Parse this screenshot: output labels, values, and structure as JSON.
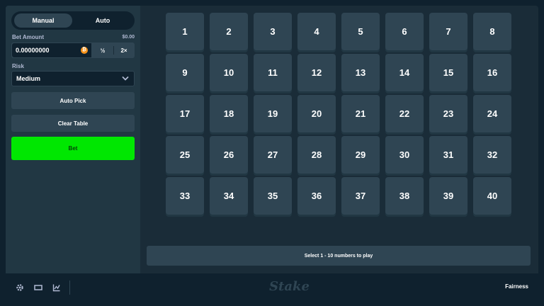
{
  "sidebar": {
    "modes": [
      "Manual",
      "Auto"
    ],
    "bet_amount_label": "Bet Amount",
    "bet_amount_usd": "$0.00",
    "bet_amount_value": "0.00000000",
    "coin_symbol": "₿",
    "half_label": "½",
    "double_label": "2×",
    "risk_label": "Risk",
    "risk_value": "Medium",
    "auto_pick_label": "Auto Pick",
    "clear_table_label": "Clear Table",
    "bet_label": "Bet"
  },
  "grid": {
    "numbers": [
      "1",
      "2",
      "3",
      "4",
      "5",
      "6",
      "7",
      "8",
      "9",
      "10",
      "11",
      "12",
      "13",
      "14",
      "15",
      "16",
      "17",
      "18",
      "19",
      "20",
      "21",
      "22",
      "23",
      "24",
      "25",
      "26",
      "27",
      "28",
      "29",
      "30",
      "31",
      "32",
      "33",
      "34",
      "35",
      "36",
      "37",
      "38",
      "39",
      "40"
    ]
  },
  "info_bar": {
    "text": "Select 1 - 10 numbers to play"
  },
  "footer": {
    "icons": [
      "settings-icon",
      "theatre-mode-icon",
      "stats-icon"
    ],
    "logo": "Stake",
    "fairness_label": "Fairness"
  },
  "colors": {
    "background": "#0f212e",
    "panel": "#213743",
    "tile": "#2f4553",
    "bet_button": "#00e701"
  }
}
